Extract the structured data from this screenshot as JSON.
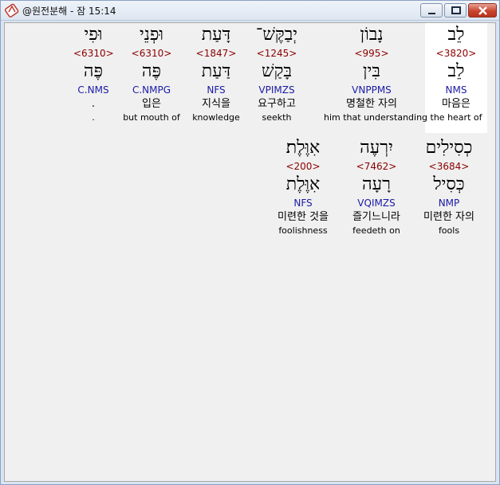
{
  "window": {
    "title": "@원전분해 - 잠 15:14"
  },
  "rows": [
    {
      "words": [
        {
          "hebrew": "לֵב",
          "strong": "<3820>",
          "lemma": "לֵב",
          "parse": "NMS",
          "korean": "마음은",
          "english": "the heart of",
          "highlight": true
        },
        {
          "hebrew": "נָבוֹן",
          "strong": "<995>",
          "lemma": "בִּין",
          "parse": "VNPPMS",
          "korean": "명철한 자의",
          "english": "him that understanding",
          "highlight": false
        },
        {
          "hebrew": "יְבַקֶּשׁ־",
          "strong": "<1245>",
          "lemma": "בָּקַשׁ",
          "parse": "VPIMZS",
          "korean": "요구하고",
          "english": "seekth",
          "highlight": false
        },
        {
          "hebrew": "דָּעַת",
          "strong": "<1847>",
          "lemma": "דַּעַת",
          "parse": "NFS",
          "korean": "지식을",
          "english": "knowledge",
          "highlight": false
        },
        {
          "hebrew": "וּפְנֵי",
          "strong": "<6310>",
          "lemma": "פֶּה",
          "parse": "C.NMPG",
          "korean": "입은",
          "english": "but mouth of",
          "highlight": false
        },
        {
          "hebrew": "וּפִי",
          "strong": "<6310>",
          "lemma": "פֶּה",
          "parse": "C.NMS",
          "korean": ".",
          "english": ".",
          "highlight": false
        }
      ]
    },
    {
      "words": [
        {
          "hebrew": "כְסִילִים",
          "strong": "<3684>",
          "lemma": "כְּסִיל",
          "parse": "NMP",
          "korean": "미련한 자의",
          "english": "fools",
          "highlight": false
        },
        {
          "hebrew": "יִרְעֶה",
          "strong": "<7462>",
          "lemma": "רָעָה",
          "parse": "VQIMZS",
          "korean": "즐기느니라",
          "english": "feedeth on",
          "highlight": false
        },
        {
          "hebrew": "אִוֶּלֶת׃",
          "strong": "<200>",
          "lemma": "אִוֶּלֶת",
          "parse": "NFS",
          "korean": "미련한 것을",
          "english": "foolishness",
          "highlight": false
        }
      ]
    }
  ]
}
